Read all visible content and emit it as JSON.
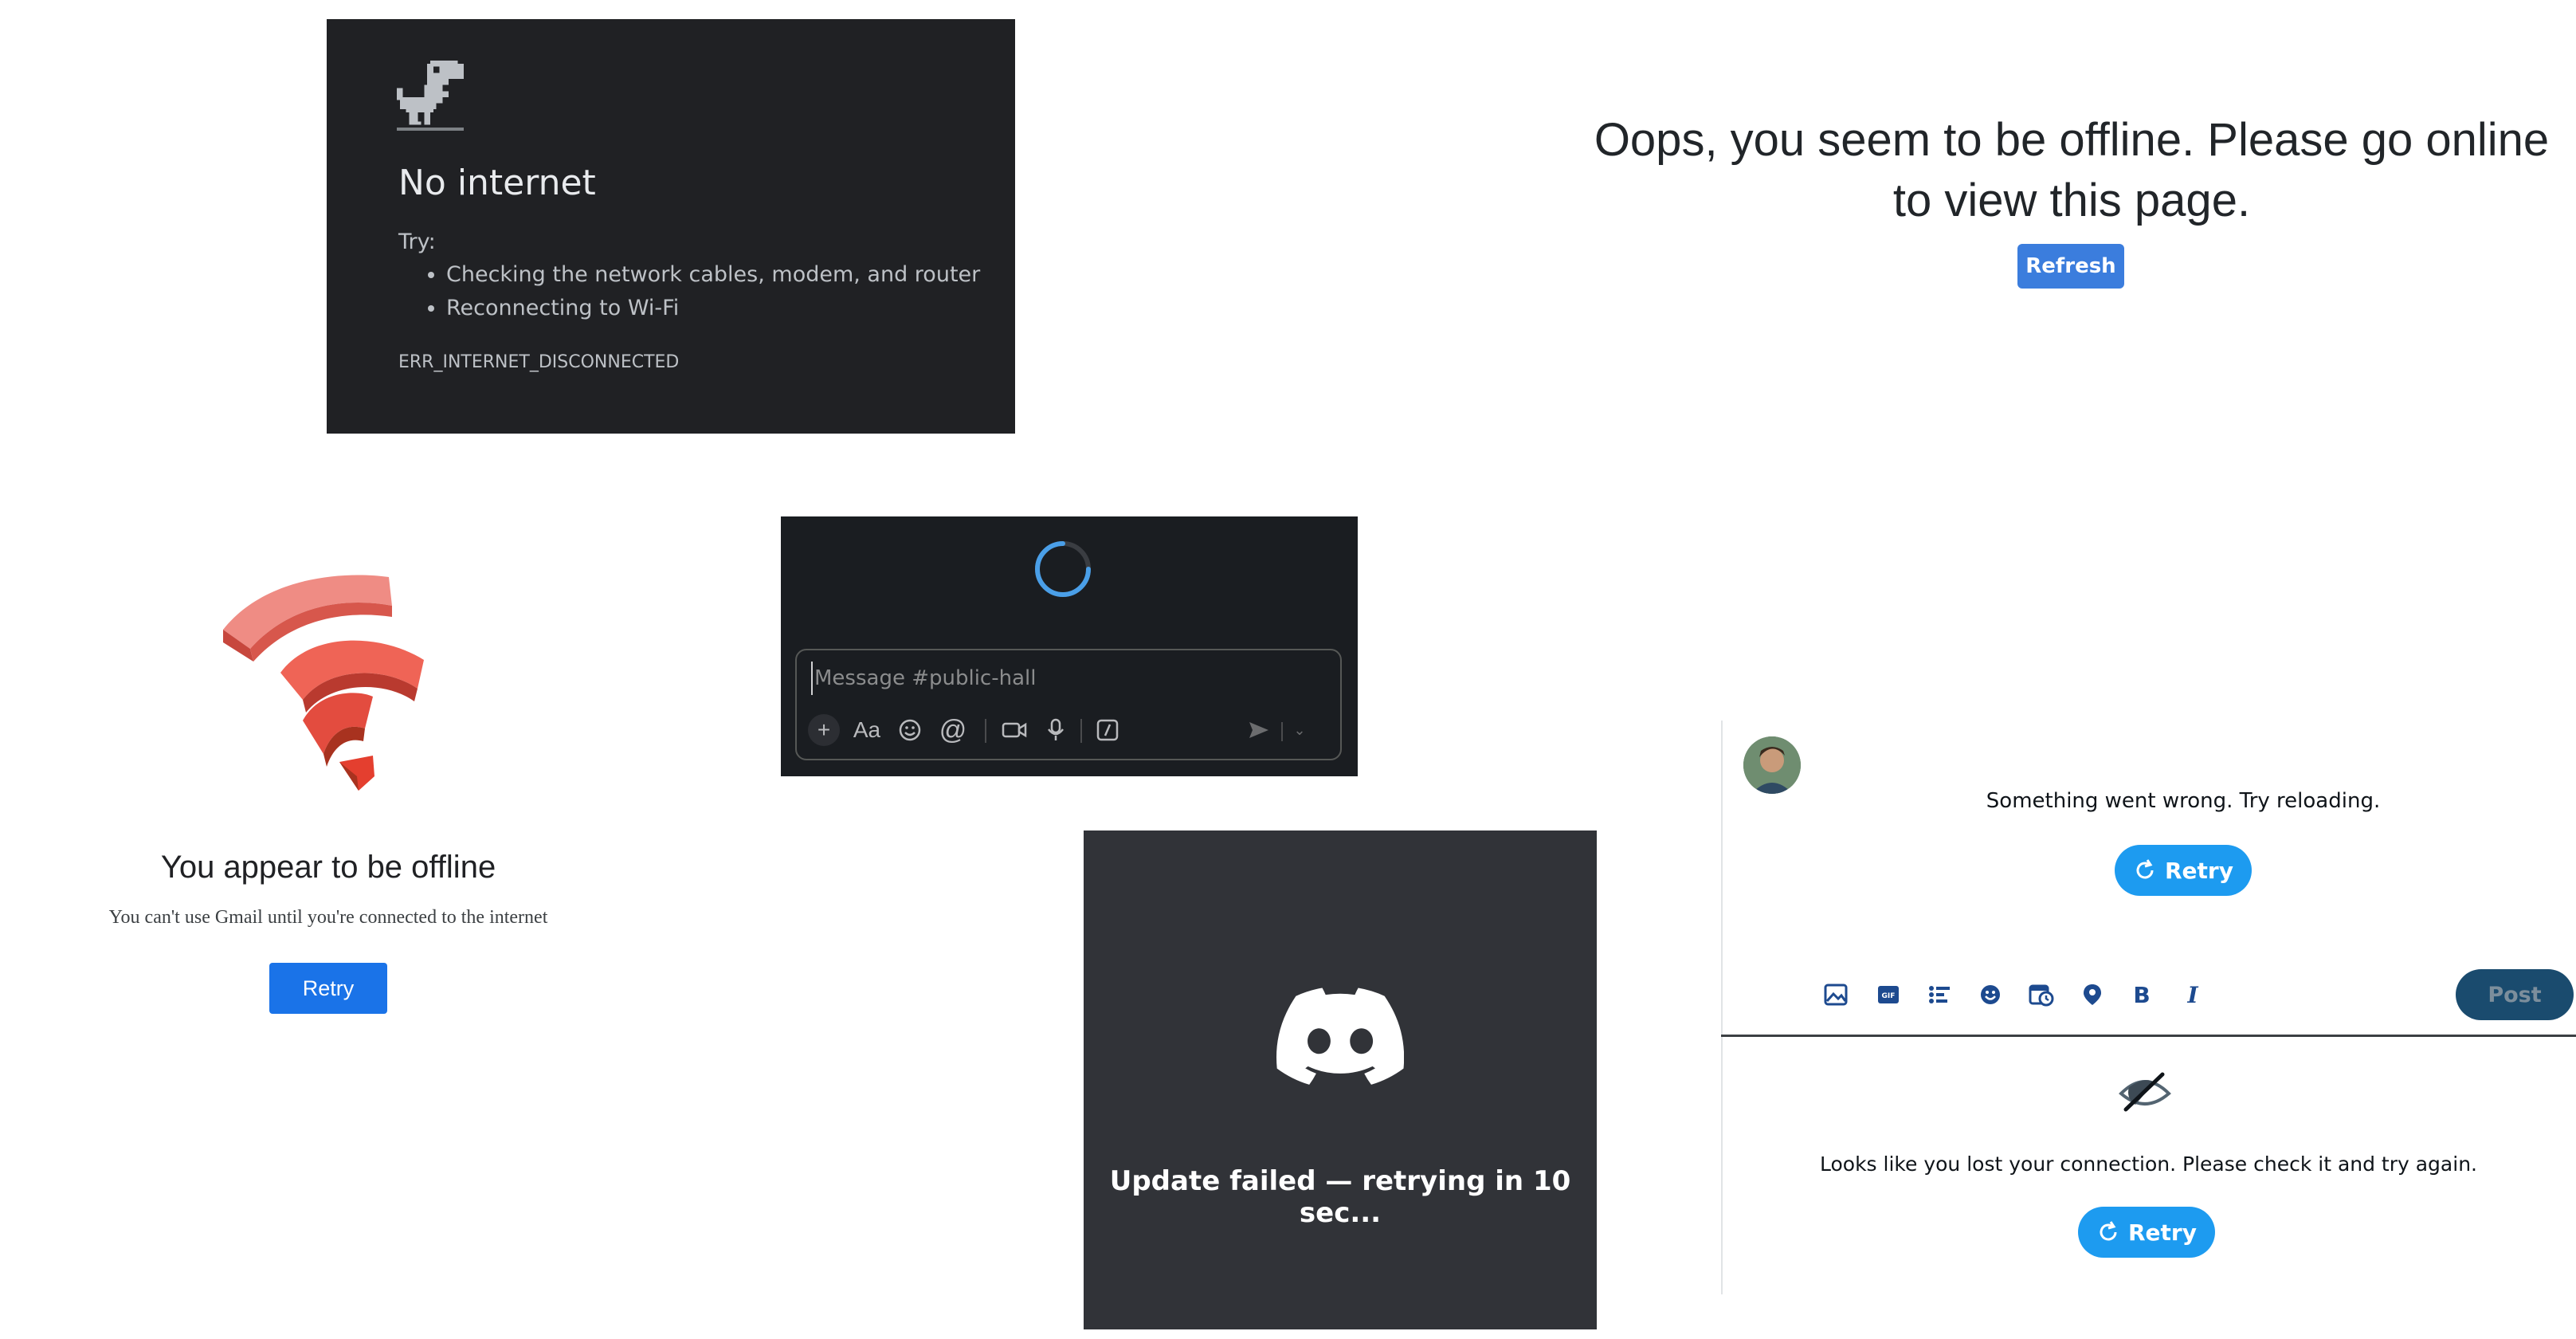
{
  "chrome": {
    "title": "No internet",
    "try_label": "Try:",
    "suggestions": [
      "Checking the network cables, modem, and router",
      "Reconnecting to Wi-Fi"
    ],
    "error_code": "ERR_INTERNET_DISCONNECTED"
  },
  "oops": {
    "message": "Oops, you seem to be offline. Please go online to view this page.",
    "button_label": "Refresh"
  },
  "gmail": {
    "title": "You appear to be offline",
    "subtitle": "You can't use Gmail until you're connected to the internet",
    "button_label": "Retry"
  },
  "slack": {
    "placeholder": "Message #public-hall",
    "format_label": "Aa"
  },
  "discord": {
    "message": "Update failed — retrying in 10 sec..."
  },
  "twitter": {
    "error_top": "Something went wrong. Try reloading.",
    "retry_label": "Retry",
    "post_label": "Post",
    "error_bottom": "Looks like you lost your connection. Please check it and try again."
  },
  "colors": {
    "chrome_bg": "#202124",
    "oops_button": "#3b7ddd",
    "gmail_button": "#1a73e8",
    "slack_bg": "#1a1d21",
    "discord_bg": "#313338",
    "twitter_blue": "#1d9bf0"
  }
}
